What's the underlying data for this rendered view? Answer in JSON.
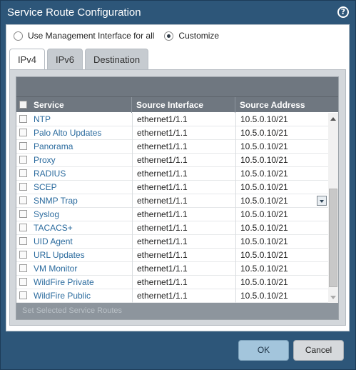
{
  "window": {
    "title": "Service Route Configuration",
    "help_icon": "question-circle-icon"
  },
  "mode": {
    "options": [
      {
        "label": "Use Management Interface for all",
        "selected": false
      },
      {
        "label": "Customize",
        "selected": true
      }
    ]
  },
  "tabs": [
    {
      "label": "IPv4",
      "active": true
    },
    {
      "label": "IPv6",
      "active": false
    },
    {
      "label": "Destination",
      "active": false
    }
  ],
  "table": {
    "columns": [
      "Service",
      "Source Interface",
      "Source Address"
    ],
    "rows": [
      {
        "service": "NTP",
        "interface": "ethernet1/1.1",
        "address": "10.5.0.10/21"
      },
      {
        "service": "Palo Alto Updates",
        "interface": "ethernet1/1.1",
        "address": "10.5.0.10/21"
      },
      {
        "service": "Panorama",
        "interface": "ethernet1/1.1",
        "address": "10.5.0.10/21"
      },
      {
        "service": "Proxy",
        "interface": "ethernet1/1.1",
        "address": "10.5.0.10/21"
      },
      {
        "service": "RADIUS",
        "interface": "ethernet1/1.1",
        "address": "10.5.0.10/21"
      },
      {
        "service": "SCEP",
        "interface": "ethernet1/1.1",
        "address": "10.5.0.10/21"
      },
      {
        "service": "SNMP Trap",
        "interface": "ethernet1/1.1",
        "address": "10.5.0.10/21"
      },
      {
        "service": "Syslog",
        "interface": "ethernet1/1.1",
        "address": "10.5.0.10/21"
      },
      {
        "service": "TACACS+",
        "interface": "ethernet1/1.1",
        "address": "10.5.0.10/21"
      },
      {
        "service": "UID Agent",
        "interface": "ethernet1/1.1",
        "address": "10.5.0.10/21"
      },
      {
        "service": "URL Updates",
        "interface": "ethernet1/1.1",
        "address": "10.5.0.10/21"
      },
      {
        "service": "VM Monitor",
        "interface": "ethernet1/1.1",
        "address": "10.5.0.10/21"
      },
      {
        "service": "WildFire Private",
        "interface": "ethernet1/1.1",
        "address": "10.5.0.10/21"
      },
      {
        "service": "WildFire Public",
        "interface": "ethernet1/1.1",
        "address": "10.5.0.10/21"
      }
    ],
    "footer_action": "Set Selected Service Routes"
  },
  "buttons": {
    "ok": "OK",
    "cancel": "Cancel"
  }
}
